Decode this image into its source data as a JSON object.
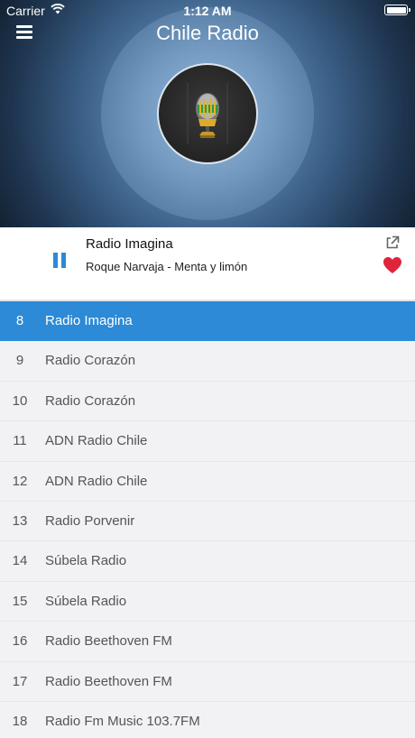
{
  "status_bar": {
    "carrier": "Carrier",
    "time": "1:12 AM"
  },
  "header": {
    "title": "Chile Radio",
    "menu_icon": "hamburger-menu-icon",
    "artwork_icon": "microphone-logo"
  },
  "player": {
    "station": "Radio Imagina",
    "track": "Roque Narvaja - Menta y limón",
    "state": "playing",
    "share_icon": "external-share-icon",
    "favorite_icon": "heart-icon",
    "favorite_color": "#e0243a",
    "accent_color": "#2c8ad6"
  },
  "stations": [
    {
      "number": "8",
      "name": "Radio Imagina",
      "active": true
    },
    {
      "number": "9",
      "name": "Radio Corazón"
    },
    {
      "number": "10",
      "name": "Radio Corazón"
    },
    {
      "number": "11",
      "name": "ADN Radio Chile"
    },
    {
      "number": "12",
      "name": "ADN Radio Chile"
    },
    {
      "number": "13",
      "name": "Radio Porvenir"
    },
    {
      "number": "14",
      "name": "Súbela Radio"
    },
    {
      "number": "15",
      "name": "Súbela Radio"
    },
    {
      "number": "16",
      "name": "Radio Beethoven FM"
    },
    {
      "number": "17",
      "name": "Radio Beethoven FM"
    },
    {
      "number": "18",
      "name": "Radio Fm Music 103.7FM"
    }
  ]
}
